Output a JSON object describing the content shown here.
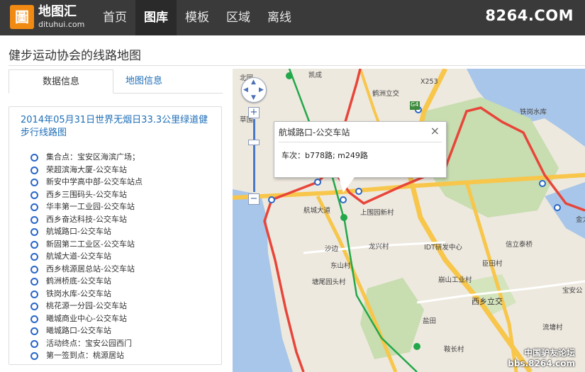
{
  "header": {
    "logo_glyph": "圖",
    "logo_cn": "地图汇",
    "logo_en": "dituhui.com",
    "nav": [
      "首页",
      "图库",
      "模板",
      "区域",
      "离线"
    ],
    "active_nav": "图库",
    "site_mark": "8264.COM"
  },
  "page": {
    "title": "健步运动协会的线路地图"
  },
  "tabs": [
    "数据信息",
    "地图信息"
  ],
  "route": {
    "title": "2014年05月31日世界无烟日33.3公里绿道健步行线路图",
    "stops": [
      "集合点：宝安区海滨广场；",
      "荣超滨海大厦-公交车站",
      "新安中学高中部-公交车站点",
      "西乡三围码头-公交车站",
      "华丰第一工业园-公交车站",
      "西乡奋达科技-公交车站",
      "航城路口-公交车站",
      "新固第二工业区-公交车站",
      "航城大道-公交车站",
      "西乡桃源居总站-公交车站",
      "鹤洲桥底-公交车站",
      "铁岗水库-公交车站",
      "桃花源一分园-公交车站",
      "曦城商业中心-公交车站",
      "曦城路口-公交车站",
      "活动终点：宝安公园西门",
      "第一签到点：桃源居站"
    ]
  },
  "map": {
    "popup": {
      "title": "航城路口-公交车站",
      "body": "车次：b778路; m249路",
      "close": "×"
    },
    "zoom_plus": "+",
    "zoom_minus": "−",
    "labels": {
      "beiyuan": "北园",
      "kaicheng": "凯成",
      "caowei": "草围",
      "hezhou": "鹤洲立交",
      "x253": "X253",
      "g4": "G4",
      "tiegang": "铁岗水库",
      "hangcheng": "航城大道",
      "shangguo": "上围园新村",
      "jingang": "金力",
      "shabian": "沙边",
      "longxing": "龙兴村",
      "idt": "IDT研发中心",
      "xinli": "信立泰桥",
      "dongshan": "东山村",
      "chentian": "臣田村",
      "tangweiyuan": "塘尾园头村",
      "shanggang": "崩山工业村",
      "xixiang": "西乡立交",
      "baoan": "宝安公",
      "yantian": "盐田",
      "liutang": "流塘村",
      "bianjian": "鞍长村"
    },
    "watermark_cn": "中国驴友论坛",
    "watermark_en": "bbs.8264.com"
  },
  "colors": {
    "route": "#e8453a",
    "stop_marker": "#2b67c6",
    "link": "#1f6fb8",
    "road_major": "#f7c64a",
    "water": "#a8c6e9",
    "park": "#c8ddb0",
    "topbar": "#3a3a3a",
    "logo": "#f08a12"
  }
}
